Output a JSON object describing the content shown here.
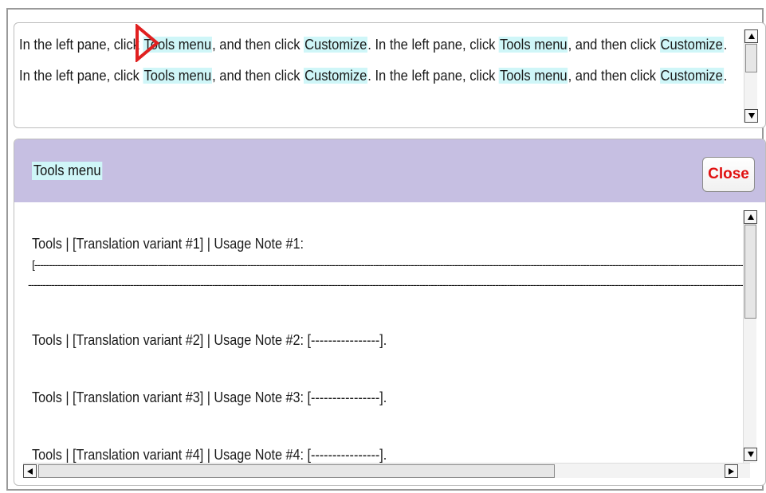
{
  "instruction_text": {
    "segments": [
      {
        "text": "In the left pane, click ",
        "hl": false
      },
      {
        "text": "Tools menu",
        "hl": true
      },
      {
        "text": ", and then click ",
        "hl": false
      },
      {
        "text": "Customize",
        "hl": true
      },
      {
        "text": ".  In the left pane, click ",
        "hl": false
      },
      {
        "text": "Tools menu",
        "hl": true
      },
      {
        "text": ", and then click ",
        "hl": false
      },
      {
        "text": "Customize",
        "hl": true
      },
      {
        "text": ".  In the left pane, click ",
        "hl": false
      },
      {
        "text": "Tools menu",
        "hl": true
      },
      {
        "text": ", and then click ",
        "hl": false
      },
      {
        "text": "Customize",
        "hl": true
      },
      {
        "text": ".  In the left pane, click ",
        "hl": false
      },
      {
        "text": "Tools menu",
        "hl": true
      },
      {
        "text": ", and then click ",
        "hl": false
      },
      {
        "text": "Customize",
        "hl": true
      },
      {
        "text": ".",
        "hl": false
      }
    ]
  },
  "panel": {
    "title": "Tools menu",
    "close_label": "Close"
  },
  "notes": [
    "Tools | [Translation variant #1] | Usage Note #1:",
    "Tools | [Translation variant #2] | Usage Note #2: [----------------].",
    "Tools | [Translation variant #3] | Usage Note #3: [----------------].",
    "Tools | [Translation variant #4] | Usage Note #4: [----------------]."
  ],
  "note1_dash_line1": "[-----------------------------------------------------------------------------------------------------------------------------------------------------------------------------------------------------------------------------------------------------------------------",
  "note1_dash_line2": "------------------------------------------------------------------------------------------------------------------------------------------------------------------------------------------------------------------------------------------------------------------------",
  "colors": {
    "highlight": "#cff6f8",
    "header_bg": "#c6bfe2",
    "close_text": "#e01010",
    "pointer": "#e02020"
  },
  "icons": {
    "pointer": "red-triangle-pointer-icon",
    "scroll_up": "arrow-up-icon",
    "scroll_down": "arrow-down-icon",
    "scroll_left": "arrow-left-icon",
    "scroll_right": "arrow-right-icon"
  }
}
